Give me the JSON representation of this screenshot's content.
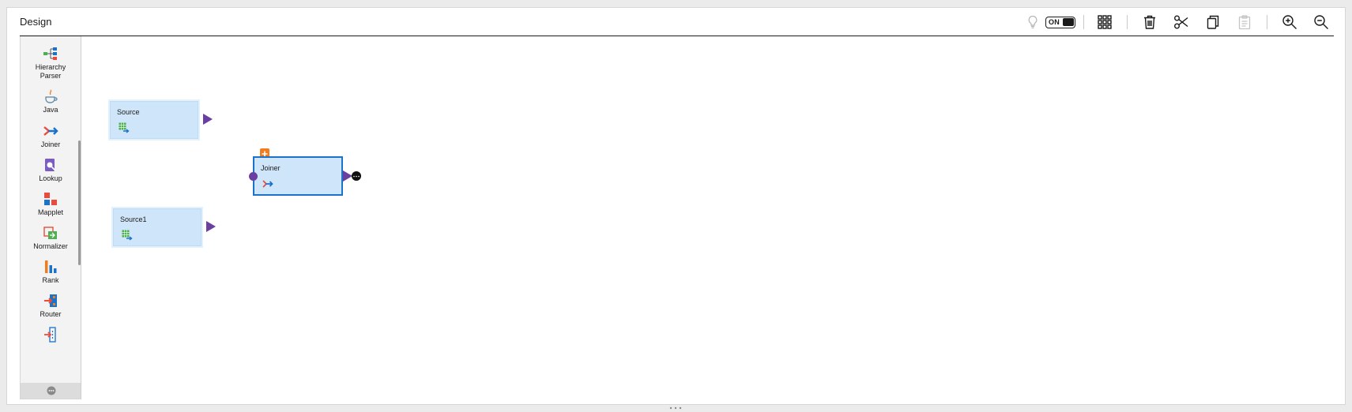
{
  "header": {
    "title": "Design"
  },
  "toolbar": {
    "toggle_label": "ON",
    "icons": [
      "lightbulb-icon",
      "grid-icon",
      "trash-icon",
      "scissors-icon",
      "copy-icon",
      "paste-icon",
      "zoom-in-icon",
      "zoom-out-icon"
    ]
  },
  "palette": {
    "items": [
      {
        "label_line1": "Hierarchy",
        "label_line2": "Parser",
        "icon": "hierarchy-parser-icon"
      },
      {
        "label": "Java",
        "icon": "java-icon"
      },
      {
        "label": "Joiner",
        "icon": "joiner-icon"
      },
      {
        "label": "Lookup",
        "icon": "lookup-icon"
      },
      {
        "label": "Mapplet",
        "icon": "mapplet-icon"
      },
      {
        "label": "Normalizer",
        "icon": "normalizer-icon"
      },
      {
        "label": "Rank",
        "icon": "rank-icon"
      },
      {
        "label": "Router",
        "icon": "router-icon"
      }
    ],
    "footer_icon": "more-icon"
  },
  "canvas": {
    "nodes": [
      {
        "label": "Source",
        "icon": "source-table-icon"
      },
      {
        "label": "Joiner",
        "icon": "joiner-icon",
        "selected": true
      },
      {
        "label": "Source1",
        "icon": "source-table-icon"
      }
    ]
  },
  "colors": {
    "accent": "#1b72c9",
    "node_fill": "#cfe6fa",
    "port": "#6b3fa0",
    "badge": "#f07c1e"
  }
}
